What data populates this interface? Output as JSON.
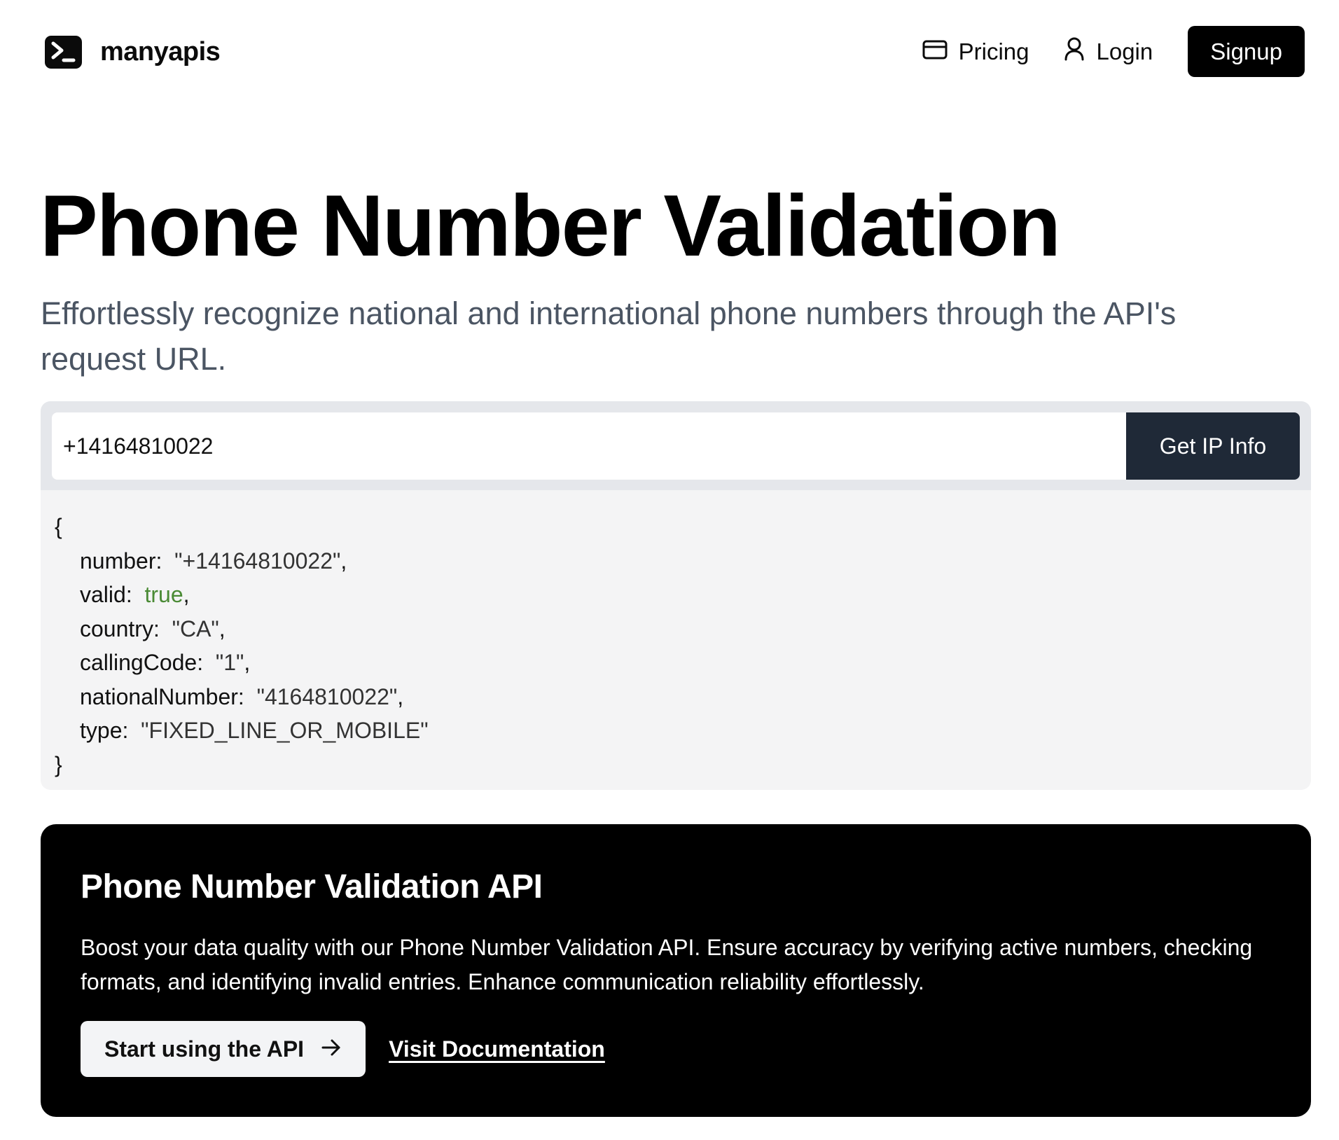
{
  "header": {
    "brand": "manyapis",
    "nav": {
      "pricing": "Pricing",
      "login": "Login",
      "signup": "Signup"
    }
  },
  "hero": {
    "title": "Phone Number Validation",
    "subtitle": "Effortlessly recognize national and international phone numbers through the API's request URL."
  },
  "request": {
    "input_value": "+14164810022",
    "button": "Get IP Info"
  },
  "response": {
    "open_brace": "{",
    "close_brace": "}",
    "fields": [
      {
        "key": "number:",
        "value": "\"+14164810022\"",
        "type": "string"
      },
      {
        "key": "valid:",
        "value": "true",
        "type": "boolean"
      },
      {
        "key": "country:",
        "value": "\"CA\"",
        "type": "string"
      },
      {
        "key": "callingCode:",
        "value": "\"1\"",
        "type": "string"
      },
      {
        "key": "nationalNumber:",
        "value": "\"4164810022\"",
        "type": "string"
      },
      {
        "key": "type:",
        "value": "\"FIXED_LINE_OR_MOBILE\"",
        "type": "string",
        "last": true
      }
    ],
    "comma": ","
  },
  "api_card": {
    "title": "Phone Number Validation API",
    "description": "Boost your data quality with our Phone Number Validation API. Ensure accuracy by verifying active numbers, checking formats, and identifying invalid entries. Enhance communication reliability effortlessly.",
    "start_button": "Start using the API",
    "docs_link": "Visit Documentation"
  },
  "icons": {
    "logo": "terminal-prompt-icon",
    "pricing": "credit-card-icon",
    "login": "user-icon",
    "start": "arrow-right-icon"
  },
  "colors": {
    "primary": "#000000",
    "button_dark": "#1f2937",
    "subtitle": "#4b5563",
    "boolean": "#4a8a35",
    "response_bg": "#f4f4f5",
    "request_bg": "#e5e7eb"
  }
}
